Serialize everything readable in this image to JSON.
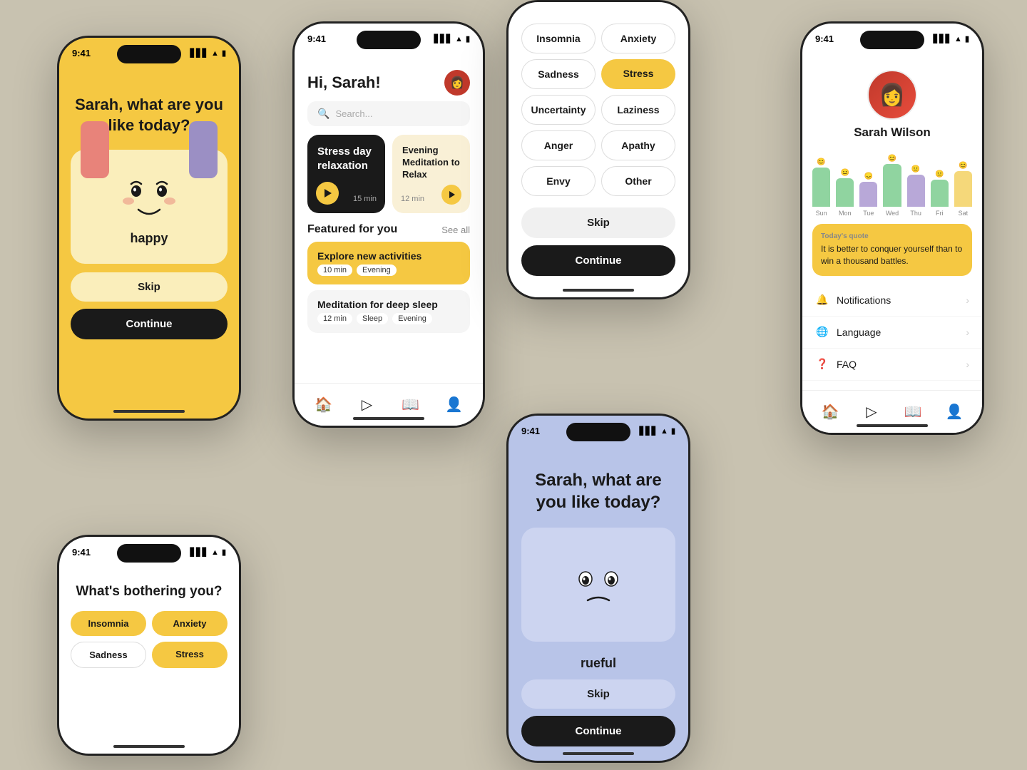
{
  "phone1": {
    "time": "9:41",
    "question": "Sarah, what are you like today?",
    "mood_label": "happy",
    "skip_label": "Skip",
    "continue_label": "Continue"
  },
  "phone2": {
    "time": "9:41",
    "title": "What's bothering you?",
    "tags": [
      {
        "label": "Insomnia",
        "style": "yellow"
      },
      {
        "label": "Anxiety",
        "style": "yellow"
      },
      {
        "label": "Sadness",
        "style": "outline"
      },
      {
        "label": "Stress",
        "style": "yellow"
      }
    ]
  },
  "phone3": {
    "time": "9:41",
    "greeting": "Hi, Sarah!",
    "search_placeholder": "Search...",
    "featured_1_title": "Stress day relaxation",
    "featured_1_duration": "15 min",
    "featured_2_title": "Evening Meditation to Relax",
    "featured_2_duration": "12 min",
    "section_title": "Featured for you",
    "see_all": "See all",
    "activity_1_title": "Explore new activities",
    "activity_1_duration": "10 min",
    "activity_1_tag": "Evening",
    "activity_2_title": "Meditation for deep sleep",
    "activity_2_duration": "12 min",
    "activity_2_tag1": "Sleep",
    "activity_2_tag2": "Evening"
  },
  "phone4": {
    "mood_tags": [
      {
        "label": "Insomnia",
        "style": "outline"
      },
      {
        "label": "Anxiety",
        "style": "outline"
      },
      {
        "label": "Sadness",
        "style": "outline"
      },
      {
        "label": "Stress",
        "style": "yellow"
      },
      {
        "label": "Uncertainty",
        "style": "outline"
      },
      {
        "label": "Laziness",
        "style": "outline"
      },
      {
        "label": "Anger",
        "style": "outline"
      },
      {
        "label": "Apathy",
        "style": "outline"
      },
      {
        "label": "Envy",
        "style": "outline"
      },
      {
        "label": "Other",
        "style": "outline"
      }
    ],
    "skip_label": "Skip",
    "continue_label": "Continue"
  },
  "phone5": {
    "time": "9:41",
    "question": "Sarah, what are you like today?",
    "mood_label": "rueful",
    "skip_label": "Skip",
    "continue_label": "Continue"
  },
  "phone6": {
    "time": "9:41",
    "profile_name": "Sarah Wilson",
    "quote_label": "Today's quote",
    "quote_text": "It is better to conquer yourself than to win a thousand battles.",
    "chart_days": [
      "Sun",
      "Mon",
      "Tue",
      "Wed",
      "Thu",
      "Fri",
      "Sat"
    ],
    "menu_items": [
      {
        "label": "Notifications",
        "icon": "🔔"
      },
      {
        "label": "Language",
        "icon": "🌐"
      },
      {
        "label": "FAQ",
        "icon": "❓"
      }
    ]
  }
}
